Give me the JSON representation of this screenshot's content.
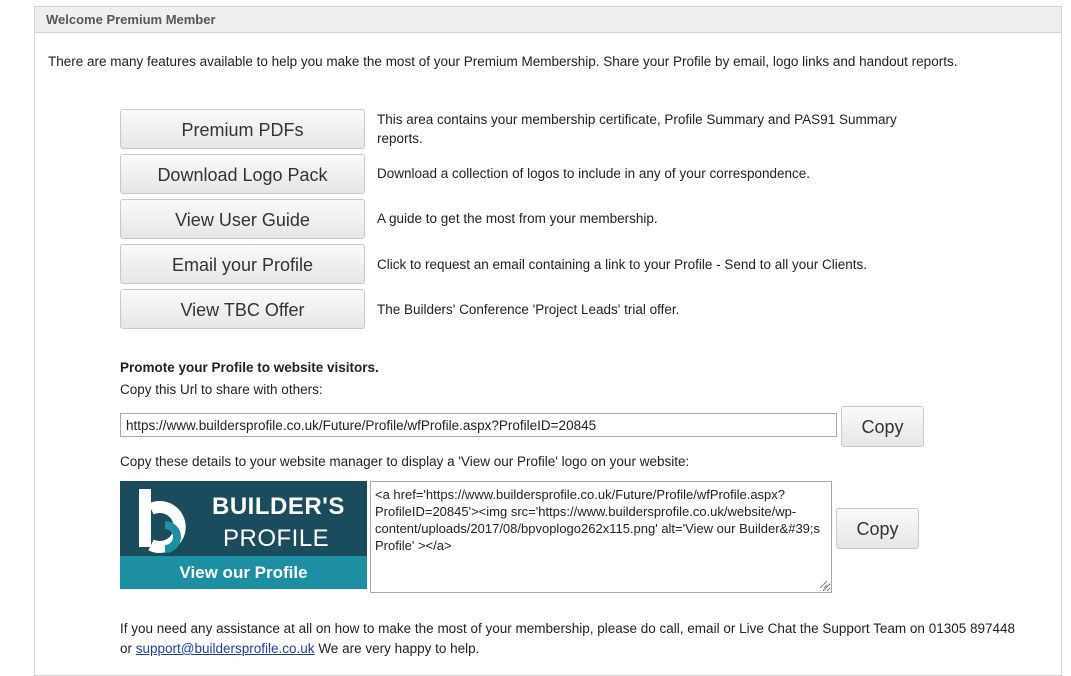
{
  "panel": {
    "header": "Welcome Premium Member",
    "intro": "There are many features available to help you make the most of your Premium Membership. Share your Profile by email, logo links and handout reports."
  },
  "features": [
    {
      "label": "Premium PDFs",
      "description": "This area contains your membership certificate, Profile Summary and PAS91 Summary reports."
    },
    {
      "label": "Download Logo Pack",
      "description": "Download a collection of logos to include in any of your correspondence."
    },
    {
      "label": "View User Guide",
      "description": "A guide to get the most from your membership."
    },
    {
      "label": "Email your Profile",
      "description": "Click to request an email containing a link to your Profile - Send to all your Clients."
    },
    {
      "label": "View TBC Offer",
      "description": "The Builders' Conference 'Project Leads' trial offer."
    }
  ],
  "promote": {
    "title": "Promote your Profile to website visitors.",
    "url_label": "Copy this Url to share with others:",
    "url_value": "https://www.buildersprofile.co.uk/Future/Profile/wfProfile.aspx?ProfileID=20845",
    "copy_label": "Copy",
    "logo_label": "Copy these details to your website manager to display a 'View our Profile' logo on your website:",
    "code_value": "<a href='https://www.buildersprofile.co.uk/Future/Profile/wfProfile.aspx?ProfileID=20845'><img src='https://www.buildersprofile.co.uk/website/wp-content/uploads/2017/08/bpvoplogo262x115.png' alt='View our Builder&#39;s Profile' ></a>",
    "copy_label_2": "Copy"
  },
  "logo": {
    "line1": "BUILDER'S",
    "line2": "PROFILE",
    "band": "View our Profile",
    "colors": {
      "dark": "#1a4c5e",
      "band": "#1c8fa3"
    }
  },
  "help": {
    "text_before": "If you need any assistance at all on how to make the most of your membership, please do call, email or Live Chat the Support Team on 01305 897448 or ",
    "email": "support@buildersprofile.co.uk",
    "text_after": " We are very happy to help."
  }
}
